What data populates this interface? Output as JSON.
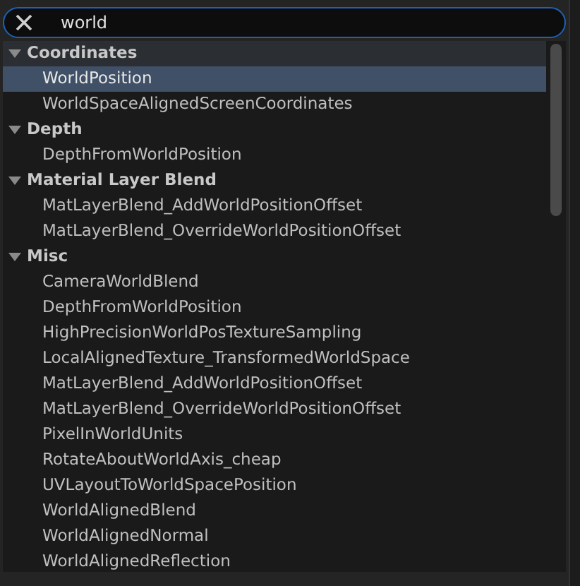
{
  "search": {
    "value": "world"
  },
  "categories": [
    {
      "label": "Coordinates",
      "expanded": true,
      "highlighted": true,
      "items": [
        {
          "label": "WorldPosition",
          "selected": true
        },
        {
          "label": "WorldSpaceAlignedScreenCoordinates",
          "selected": false
        }
      ]
    },
    {
      "label": "Depth",
      "expanded": true,
      "highlighted": false,
      "items": [
        {
          "label": "DepthFromWorldPosition",
          "selected": false
        }
      ]
    },
    {
      "label": "Material Layer Blend",
      "expanded": true,
      "highlighted": false,
      "items": [
        {
          "label": "MatLayerBlend_AddWorldPositionOffset",
          "selected": false
        },
        {
          "label": "MatLayerBlend_OverrideWorldPositionOffset",
          "selected": false
        }
      ]
    },
    {
      "label": "Misc",
      "expanded": true,
      "highlighted": false,
      "items": [
        {
          "label": "CameraWorldBlend",
          "selected": false
        },
        {
          "label": "DepthFromWorldPosition",
          "selected": false
        },
        {
          "label": "HighPrecisionWorldPosTextureSampling",
          "selected": false
        },
        {
          "label": "LocalAlignedTexture_TransformedWorldSpace",
          "selected": false
        },
        {
          "label": "MatLayerBlend_AddWorldPositionOffset",
          "selected": false
        },
        {
          "label": "MatLayerBlend_OverrideWorldPositionOffset",
          "selected": false
        },
        {
          "label": "PixelInWorldUnits",
          "selected": false
        },
        {
          "label": "RotateAboutWorldAxis_cheap",
          "selected": false
        },
        {
          "label": "UVLayoutToWorldSpacePosition",
          "selected": false
        },
        {
          "label": "WorldAlignedBlend",
          "selected": false
        },
        {
          "label": "WorldAlignedNormal",
          "selected": false
        },
        {
          "label": "WorldAlignedReflection",
          "selected": false
        }
      ]
    }
  ]
}
